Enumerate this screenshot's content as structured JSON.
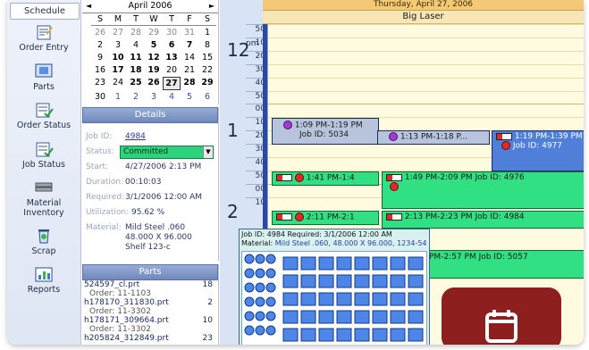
{
  "nav": {
    "schedule_label": "Schedule",
    "items": [
      {
        "label": "Order Entry",
        "icon": "order-entry-icon"
      },
      {
        "label": "Parts",
        "icon": "parts-icon"
      },
      {
        "label": "Order Status",
        "icon": "order-status-icon"
      },
      {
        "label": "Job Status",
        "icon": "job-status-icon"
      },
      {
        "label": "Material Inventory",
        "icon": "material-inventory-icon"
      },
      {
        "label": "Scrap",
        "icon": "scrap-icon"
      },
      {
        "label": "Reports",
        "icon": "reports-icon"
      }
    ]
  },
  "calendar": {
    "month_label": "April 2006",
    "prev": "◄",
    "next": "►",
    "weekdays": [
      "S",
      "M",
      "T",
      "W",
      "T",
      "F",
      "S"
    ],
    "weeks": [
      [
        "26",
        "27",
        "28",
        "29",
        "30",
        "31",
        "1"
      ],
      [
        "2",
        "3",
        "4",
        "5",
        "6",
        "7",
        "8"
      ],
      [
        "9",
        "10",
        "11",
        "12",
        "13",
        "14",
        "15"
      ],
      [
        "16",
        "17",
        "18",
        "19",
        "20",
        "21",
        "22"
      ],
      [
        "23",
        "24",
        "25",
        "26",
        "27",
        "28",
        "29"
      ],
      [
        "30",
        "1",
        "2",
        "3",
        "4",
        "5",
        "6"
      ]
    ],
    "selected": "27"
  },
  "details": {
    "header": "Details",
    "job_id_label": "Job ID:",
    "job_id": "4984",
    "status_label": "Status:",
    "status": "Committed",
    "start_label": "Start:",
    "start": "4/27/2006 2:13 PM",
    "duration_label": "Duration:",
    "duration": "00:10:03",
    "required_label": "Required:",
    "required": "3/1/2006 12:00 AM",
    "utilization_label": "Utilization:",
    "utilization": "95.62 %",
    "material_label": "Material:",
    "material_line1": "Mild Steel .060",
    "material_line2": "48.000 X 96.000",
    "material_line3": "Shelf 123-c"
  },
  "parts": {
    "header": "Parts",
    "rows": [
      {
        "name": "524597_cl.prt",
        "qty": "18",
        "order": "Order: 11-1103"
      },
      {
        "name": "h178170_311830.prt",
        "qty": "2",
        "order": "Order: 11-3302"
      },
      {
        "name": "h178171_309664.prt",
        "qty": "10",
        "order": "Order: 11-3302"
      },
      {
        "name": "h205824_312849.prt",
        "qty": "23",
        "order": ""
      }
    ]
  },
  "scheduler": {
    "day_label": "Thursday, April 27, 2006",
    "resource": "Big Laser",
    "hour12": "12",
    "pm": "pm",
    "hour1": "1",
    "hour2": "2",
    "minute_marks": [
      "50",
      "10",
      "20",
      "30",
      "40",
      "50",
      "00",
      "10",
      "20",
      "30",
      "40",
      "50",
      "00",
      "10"
    ],
    "jobs": {
      "j1_time": "1:09 PM-1:19 PM",
      "j1_id": "Job ID: 5034",
      "j2_time": "1:13 PM-1:18 P...",
      "j3_time": "1:19 PM-1:39 PM",
      "j3_id": "Job ID: 4977",
      "j4_time": "1:41 PM-1:4",
      "j5_time": "1:49 PM-2:09 PM Job ID: 4976",
      "j6_time": "2:11 PM-2:1",
      "j7_time": "2:13 PM-2:23 PM Job ID: 4984",
      "j8_time": "PM-2:57 PM Job ID: 5057"
    }
  },
  "popup": {
    "line1": "Job ID:   4984       Required: 3/1/2006 12:00 AM",
    "line2_label": "Material:",
    "line2_value": "Mild Steel .060, 48.000 X 96.000, 1234-54"
  },
  "colors": {
    "committed": "#2fd27c",
    "job_gray": "#b8c4dc",
    "job_blue": "#4f7fd9",
    "overlay": "#8e1f1f"
  }
}
